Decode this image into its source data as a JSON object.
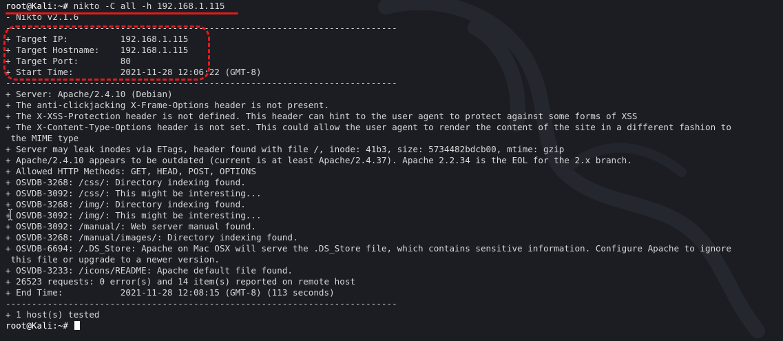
{
  "terminal": {
    "command_prompt": "root@Kali:~# ",
    "command": "nikto -C all -h 192.168.1.115",
    "lines": [
      "- Nikto v2.1.6",
      "---------------------------------------------------------------------------",
      "+ Target IP:          192.168.1.115",
      "+ Target Hostname:    192.168.1.115",
      "+ Target Port:        80",
      "+ Start Time:         2021-11-28 12:06:22 (GMT-8)",
      "---------------------------------------------------------------------------",
      "+ Server: Apache/2.4.10 (Debian)",
      "+ The anti-clickjacking X-Frame-Options header is not present.",
      "+ The X-XSS-Protection header is not defined. This header can hint to the user agent to protect against some forms of XSS",
      "+ The X-Content-Type-Options header is not set. This could allow the user agent to render the content of the site in a different fashion to",
      " the MIME type",
      "+ Server may leak inodes via ETags, header found with file /, inode: 41b3, size: 5734482bdcb00, mtime: gzip",
      "+ Apache/2.4.10 appears to be outdated (current is at least Apache/2.4.37). Apache 2.2.34 is the EOL for the 2.x branch.",
      "+ Allowed HTTP Methods: GET, HEAD, POST, OPTIONS",
      "+ OSVDB-3268: /css/: Directory indexing found.",
      "+ OSVDB-3092: /css/: This might be interesting...",
      "+ OSVDB-3268: /img/: Directory indexing found.",
      "+ OSVDB-3092: /img/: This might be interesting...",
      "+ OSVDB-3092: /manual/: Web server manual found.",
      "+ OSVDB-3268: /manual/images/: Directory indexing found.",
      "+ OSVDB-6694: /.DS_Store: Apache on Mac OSX will serve the .DS_Store file, which contains sensitive information. Configure Apache to ignore",
      " this file or upgrade to a newer version.",
      "+ OSVDB-3233: /icons/README: Apache default file found.",
      "+ 26523 requests: 0 error(s) and 14 item(s) reported on remote host",
      "+ End Time:           2021-11-28 12:08:15 (GMT-8) (113 seconds)",
      "---------------------------------------------------------------------------",
      "+ 1 host(s) tested"
    ],
    "final_prompt": "root@Kali:~# "
  },
  "colors": {
    "background": "#1b1d23",
    "text": "#d8d8d8",
    "annotation": "#e21b1b"
  },
  "icons": [
    "kali-dragon-logo",
    "text-cursor-icon"
  ]
}
